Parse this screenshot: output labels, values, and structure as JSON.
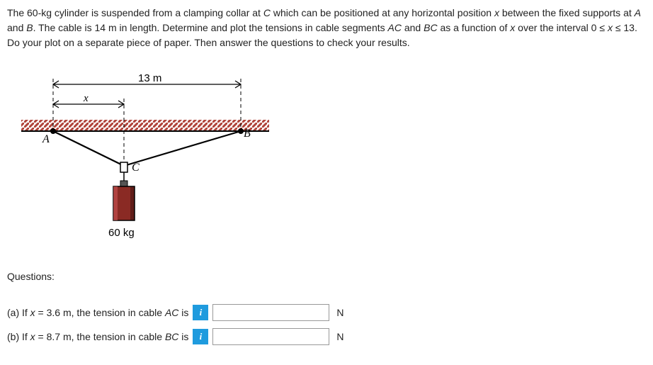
{
  "problem": {
    "p_before_c": "The 60-kg cylinder is suspended from a clamping collar at ",
    "c": "C",
    "p_after_c": " which can be positioned at any horizontal position ",
    "x1": "x",
    "p_after_x1": " between the fixed supports at ",
    "a": "A",
    "p_and": " and ",
    "b": "B",
    "p_after_b": ". The cable is 14 m in length. Determine and plot the tensions in cable segments ",
    "ac": "AC",
    "p_and2": " and ",
    "bc": "BC",
    "p_after_bc": " as a function of ",
    "x2": "x",
    "p_over": " over the interval 0 ≤ ",
    "x3": "x",
    "p_end": " ≤ 13. Do your plot on a separate piece of paper. Then answer the questions to check your results."
  },
  "diagram": {
    "span_label": "13 m",
    "x_label": "x",
    "label_a": "A",
    "label_b": "B",
    "label_c": "C",
    "mass_label": "60 kg"
  },
  "questions_label": "Questions:",
  "qa": {
    "prefix": "(a) If ",
    "x": "x",
    "value": " = 3.6 m, the tension in cable ",
    "seg": "AC",
    "suffix": " is",
    "unit": "N"
  },
  "qb": {
    "prefix": "(b) If ",
    "x": "x",
    "value": " = 8.7 m, the tension in cable ",
    "seg": "BC",
    "suffix": " is",
    "unit": "N"
  },
  "info_glyph": "i"
}
